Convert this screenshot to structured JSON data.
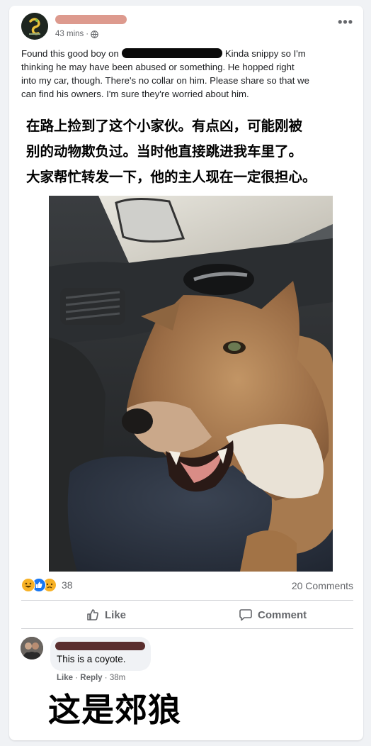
{
  "post": {
    "time": "43 mins",
    "separator": "·",
    "menu_icon": "more-horizontal-icon",
    "audience_icon": "globe-icon",
    "text_lines": {
      "l1a": "Found this good boy on",
      "l1b": "Kinda snippy so I'm",
      "l2": "thinking he may have been abused or something. He hopped right",
      "l3": "into my car, though. There's no collar on him. Please share so that we",
      "l4": "can find his owners. I'm sure they're worried about him."
    },
    "caption_cn": [
      "在路上捡到了这个小家伙。有点凶，可能刚被",
      "别的动物欺负过。当时他直接跳进我车里了。",
      "大家帮忙转发一下，他的主人现在一定很担心。"
    ],
    "photo": {
      "subject": "coyote in car passenger seat"
    }
  },
  "stats": {
    "reaction_icons": [
      "haha-icon",
      "like-icon",
      "sad-icon"
    ],
    "reaction_count": "38",
    "comments": "20 Comments"
  },
  "actions": {
    "like_label": "Like",
    "comment_label": "Comment"
  },
  "comment": {
    "text": "This is a coyote.",
    "like": "Like",
    "dot": "·",
    "reply": "Reply",
    "time": "38m",
    "caption_cn": "这是郊狼"
  },
  "colors": {
    "link_gray": "#65676b",
    "name_redaction": "#dd9a8e",
    "redaction_black": "#0a0a0a"
  }
}
